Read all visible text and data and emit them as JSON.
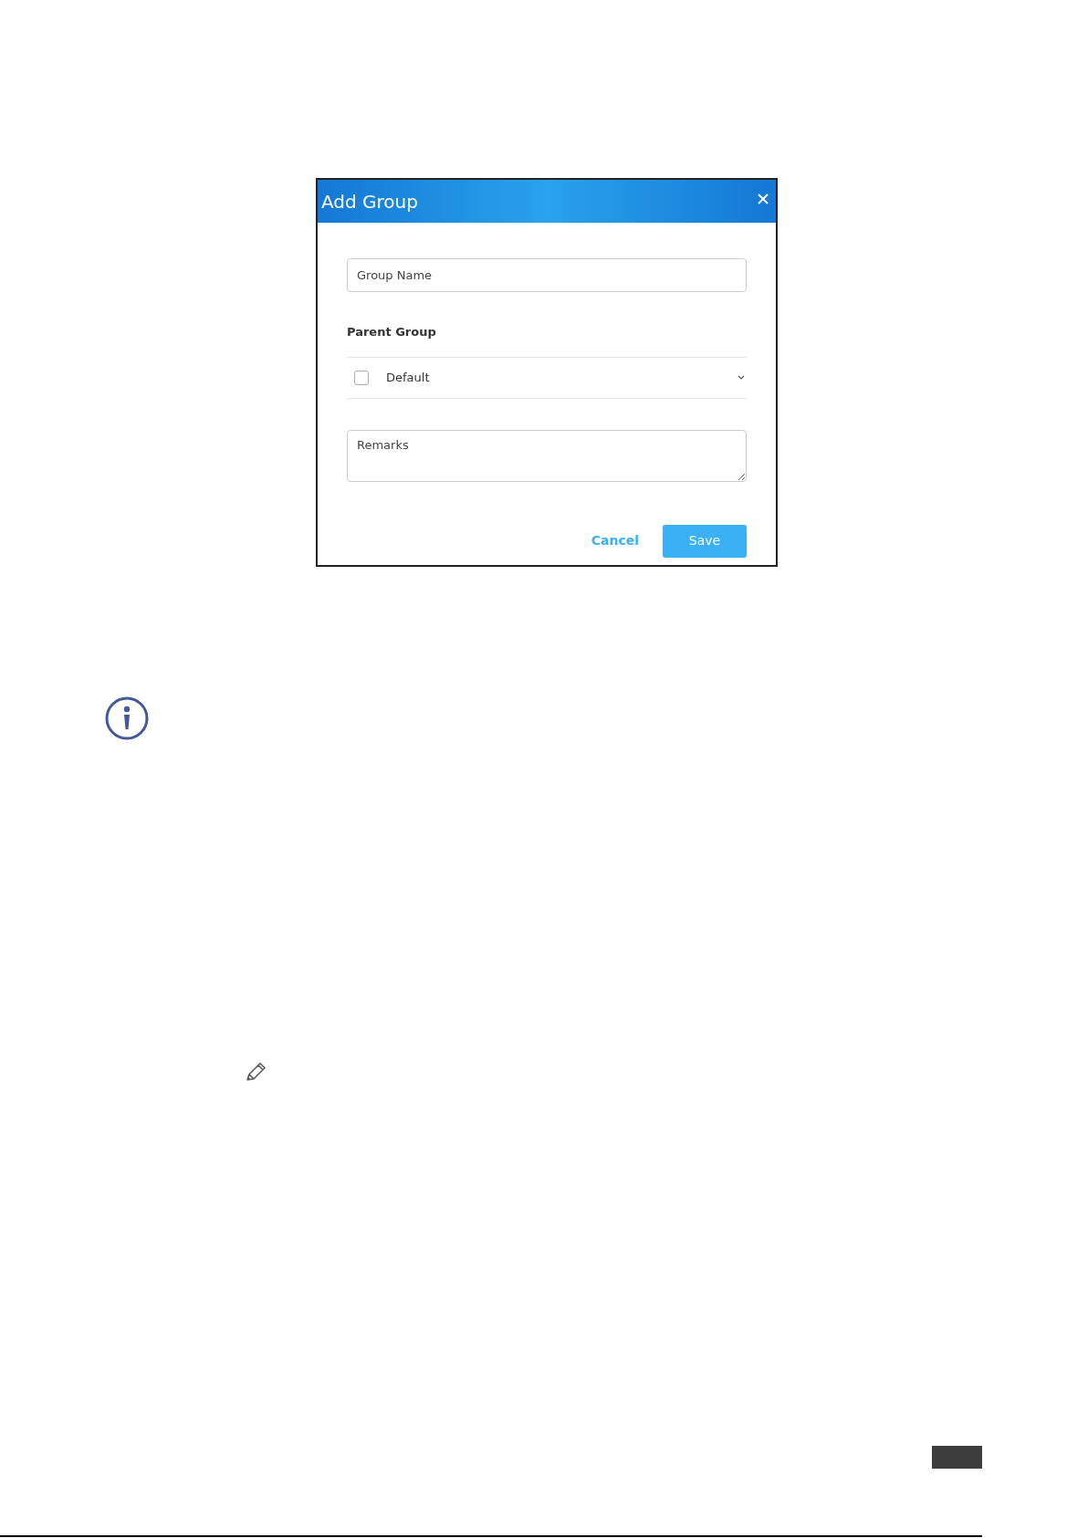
{
  "dialog": {
    "title": "Add Group",
    "group_name": {
      "placeholder": "Group Name"
    },
    "parent_group": {
      "label": "Parent Group",
      "items": [
        {
          "label": "Default",
          "checked": false
        }
      ]
    },
    "remarks": {
      "placeholder": "Remarks"
    },
    "buttons": [
      {
        "label": "Cancel",
        "kind": "link"
      },
      {
        "label": "Save",
        "kind": "primary"
      }
    ]
  }
}
